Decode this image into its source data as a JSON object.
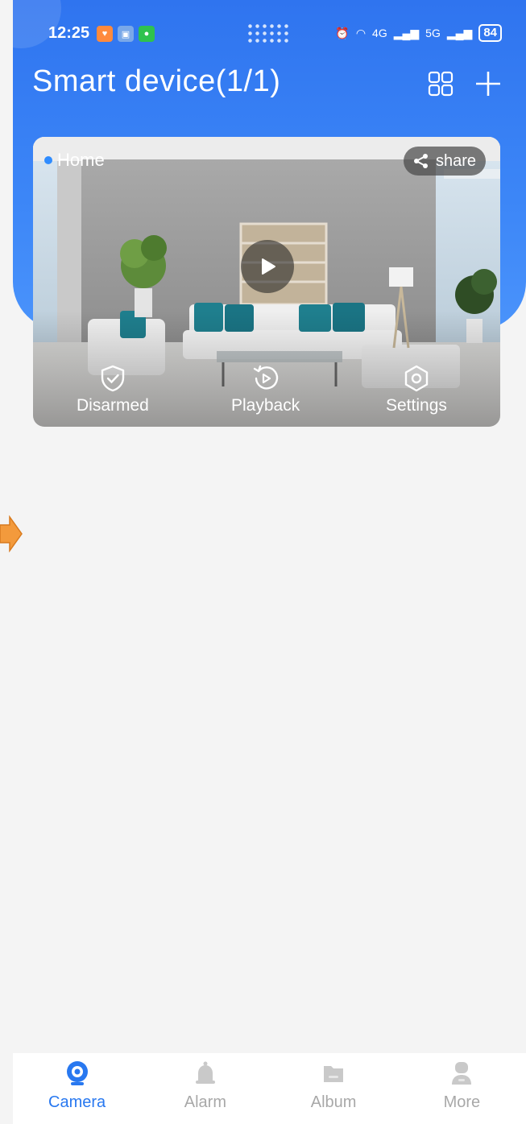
{
  "status": {
    "time": "12:25",
    "battery": "84",
    "net1": "4G",
    "net2": "5G"
  },
  "header": {
    "title": "Smart device(1/1)"
  },
  "device_card": {
    "name": "Home",
    "share_label": "share",
    "actions": {
      "disarmed": "Disarmed",
      "playback": "Playback",
      "settings": "Settings"
    }
  },
  "tabs": {
    "camera": "Camera",
    "alarm": "Alarm",
    "album": "Album",
    "more": "More"
  },
  "colors": {
    "accent": "#2878f0",
    "header": "#3c86f7",
    "tab_inactive": "#a8a8a8"
  }
}
